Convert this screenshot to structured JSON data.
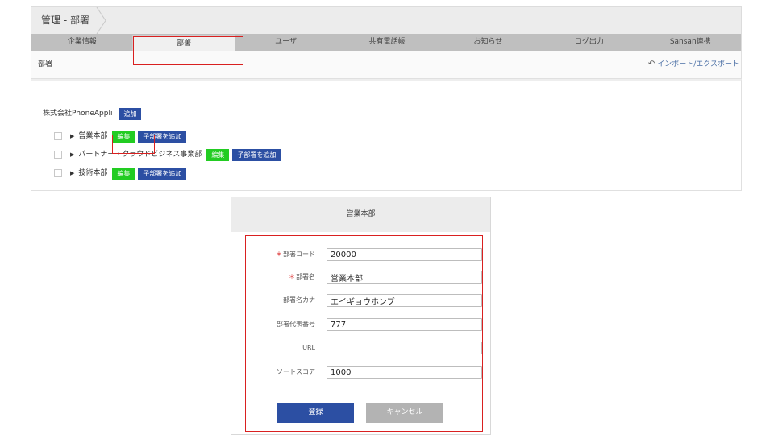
{
  "breadcrumb": {
    "text": "管理 - 部署"
  },
  "tabs": [
    {
      "label": "企業情報"
    },
    {
      "label": "部署"
    },
    {
      "label": "ユーザ"
    },
    {
      "label": "共有電話帳"
    },
    {
      "label": "お知らせ"
    },
    {
      "label": "ログ出力"
    },
    {
      "label": "Sansan連携"
    }
  ],
  "section": {
    "title": "部署",
    "import_export": "インポート/エクスポート"
  },
  "tree": {
    "company": "株式会社PhoneAppli",
    "add_label": "追加",
    "edit_label": "編集",
    "add_child_label": "子部署を追加",
    "departments": [
      {
        "name": "営業本部"
      },
      {
        "name": "パートナー・クラウドビジネス事業部"
      },
      {
        "name": "技術本部"
      }
    ]
  },
  "modal": {
    "title": "営業本部",
    "required_mark": "＊",
    "fields": {
      "code": {
        "label": "部署コード",
        "value": "20000"
      },
      "name": {
        "label": "部署名",
        "value": "営業本部"
      },
      "kana": {
        "label": "部署名カナ",
        "value": "エイギョウホンブ"
      },
      "phone": {
        "label": "部署代表番号",
        "value": "777"
      },
      "url": {
        "label": "URL",
        "value": ""
      },
      "sort": {
        "label": "ソートスコア",
        "value": "1000"
      }
    },
    "submit_label": "登録",
    "cancel_label": "キャンセル"
  },
  "colors": {
    "primary": "#2c4fa3",
    "edit_green": "#22cc22",
    "highlight_red": "#d92020",
    "cancel_gray": "#b3b3b3"
  }
}
